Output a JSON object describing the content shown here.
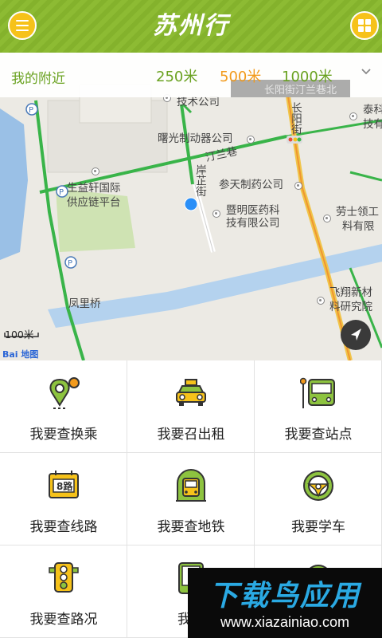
{
  "header": {
    "title": "苏州行",
    "menu_icon": "menu-icon",
    "apps_icon": "grid-icon",
    "accent": "#8dbb33",
    "button_color": "#f6c21a"
  },
  "nearby": {
    "label": "我的附近",
    "options": [
      "250米",
      "500米",
      "1000米"
    ],
    "selected": "500米",
    "selected_color": "#f29a1c"
  },
  "map": {
    "labels": {
      "tech_co": "技术公司",
      "changyang_road": "长阳街",
      "motor_co": "曙光制动器公司",
      "tinglan_lane": "汀兰巷",
      "an_zhi_street": "岸芷街",
      "sheng_yi": "生益轩国际",
      "supply_chain": "供应链平台",
      "pharma": "参天制药公司",
      "ming_pharma_1": "暨明医药科",
      "ming_pharma_2": "技有限公司",
      "tai_1": "泰科",
      "tai_2": "技有",
      "labor_1": "劳士领工",
      "labor_2": "料有限",
      "feixiang_1": "飞翔新材",
      "feixiang_2": "料研究院",
      "fengli_bridge": "凤里桥",
      "faded_top": "长阳街汀兰巷北"
    },
    "scale": "100米",
    "logo": "Bai 地图",
    "locate_icon": "navigation-arrow-icon"
  },
  "features": [
    {
      "label": "我要查换乘",
      "icon": "transfer-pin-icon"
    },
    {
      "label": "我要召出租",
      "icon": "taxi-icon"
    },
    {
      "label": "我要查站点",
      "icon": "bus-stop-icon"
    },
    {
      "label": "我要查线路",
      "icon": "route-8-icon"
    },
    {
      "label": "我要查地铁",
      "icon": "subway-icon"
    },
    {
      "label": "我要学车",
      "icon": "steering-wheel-icon"
    },
    {
      "label": "我要查路况",
      "icon": "traffic-light-icon"
    },
    {
      "label": "我要",
      "icon": "phone-icon"
    },
    {
      "label": "",
      "icon": "more-icon"
    }
  ],
  "watermark": {
    "title": "下载鸟应用",
    "url": "www.xiazainiao.com"
  }
}
